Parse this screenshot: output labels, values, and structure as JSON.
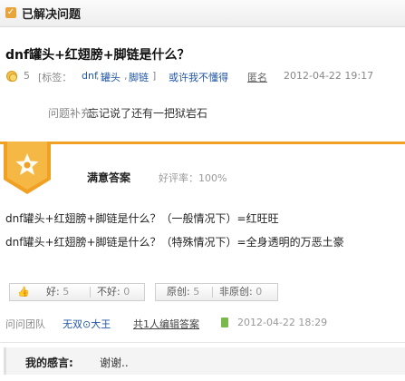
{
  "header": {
    "solved_label": "已解决问题"
  },
  "question": {
    "title": "dnf罐头+红翅膀+脚链是什么？",
    "points": "5",
    "tags_prefix": "[标签：",
    "tags": [
      "dnf",
      "罐头",
      "脚链"
    ],
    "tags_suffix": "]",
    "report_link": "或许我不懂得",
    "anonymous": "匿名",
    "time": "2012-04-22 19:17",
    "supplement_label": "问题补充:",
    "supplement_text": "忘记说了还有一把狱岩石"
  },
  "answer": {
    "section_title": "满意答案",
    "rate_label": "好评率：100%",
    "lines": [
      "dnf罐头+红翅膀+脚链是什么？（一般情况下）=红旺旺",
      "dnf罐头+红翅膀+脚链是什么？（特殊情况下）=全身透明的万恶土豪"
    ],
    "vote": {
      "good_label": "好:",
      "good_count": "5",
      "bad_label": "不好:",
      "bad_count": "0"
    },
    "origin": {
      "orig_label": "原创:",
      "orig_count": "5",
      "nonorig_label": "非原创:",
      "nonorig_count": "0"
    },
    "team": "问问团队",
    "author": "无双⊙大王",
    "editors": "共1人编辑答案",
    "time": "2012-04-22 18:29"
  },
  "thanks": {
    "label": "我的感言:",
    "text": "谢谢.."
  },
  "colors": {
    "accent": "#f0a023",
    "link": "#2156a5"
  }
}
